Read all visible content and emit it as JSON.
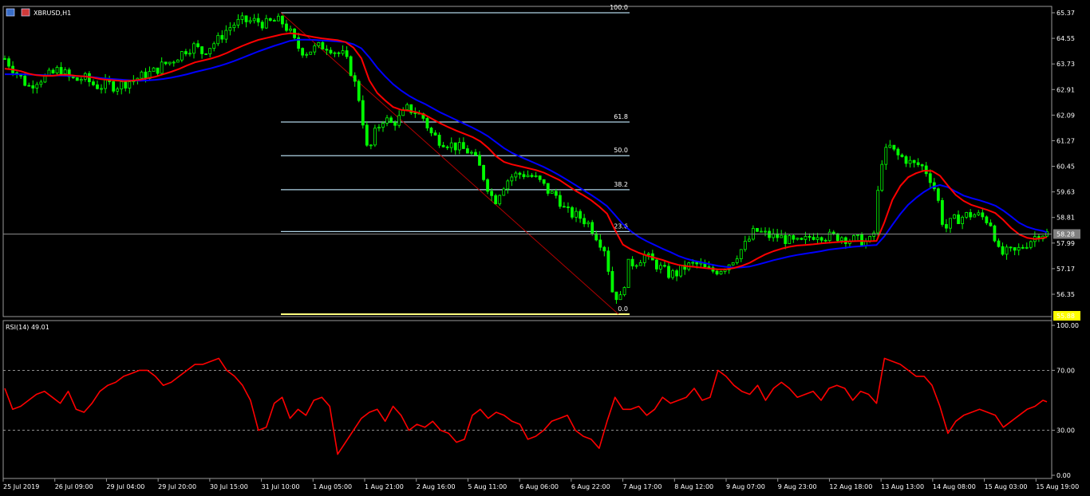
{
  "header": {
    "symbol_label": "XBRUSD,H1",
    "rsi_label": "RSI(14) 49.01"
  },
  "price_axis": {
    "ticks": [
      "65.37",
      "64.55",
      "63.73",
      "62.91",
      "62.09",
      "61.27",
      "60.45",
      "59.63",
      "58.81",
      "57.99",
      "57.17",
      "56.35"
    ],
    "tick_values": [
      65.37,
      64.55,
      63.73,
      62.91,
      62.09,
      61.27,
      60.45,
      59.63,
      58.81,
      57.99,
      57.17,
      56.35
    ],
    "current_price_label": "58.28",
    "current_price": 58.28,
    "low_price_label": "55.88",
    "low_price": 55.88
  },
  "rsi_axis": {
    "ticks": [
      "100.00",
      "70.00",
      "30.00",
      "0.00"
    ],
    "tick_values": [
      100,
      70,
      30,
      0
    ],
    "levels": [
      70,
      30
    ]
  },
  "time_axis": {
    "labels": [
      "25 Jul 2019",
      "26 Jul 09:00",
      "29 Jul 04:00",
      "29 Jul 20:00",
      "30 Jul 15:00",
      "31 Jul 10:00",
      "1 Aug 05:00",
      "1 Aug 21:00",
      "2 Aug 16:00",
      "5 Aug 11:00",
      "6 Aug 06:00",
      "6 Aug 22:00",
      "7 Aug 17:00",
      "8 Aug 12:00",
      "9 Aug 07:00",
      "9 Aug 23:00",
      "12 Aug 18:00",
      "13 Aug 13:00",
      "14 Aug 08:00",
      "15 Aug 03:00",
      "15 Aug 19:00"
    ]
  },
  "fibonacci": {
    "levels": [
      {
        "label": "100.0",
        "price": 65.37
      },
      {
        "label": "61.8",
        "price": 61.87
      },
      {
        "label": "50.0",
        "price": 60.79
      },
      {
        "label": "38.2",
        "price": 59.7
      },
      {
        "label": "23.6",
        "price": 58.36
      },
      {
        "label": "0.0",
        "price": 55.88
      }
    ]
  },
  "colors": {
    "background": "#000000",
    "candle": "#00ff00",
    "ma_fast": "#ff0000",
    "ma_slow": "#0000ff",
    "rsi": "#ff0000",
    "fib": "#b0d4e6",
    "fib_zero": "#ffff80",
    "grid_text": "#ffffff",
    "current_price_bg": "#808080",
    "low_price_bg": "#ffff00"
  },
  "chart_data": {
    "type": "line",
    "x": [
      0,
      10,
      20,
      30,
      40,
      50,
      60,
      70,
      80,
      90,
      100,
      110,
      120,
      130,
      140,
      150,
      160,
      170,
      180,
      190,
      200,
      210,
      220,
      230,
      240,
      250,
      260,
      270,
      280,
      290,
      300,
      310,
      320,
      330,
      340,
      350,
      360,
      370,
      380,
      390,
      400,
      410,
      420,
      430,
      440,
      450,
      460,
      470,
      480,
      490,
      500,
      510,
      520,
      530,
      540,
      550,
      560,
      570,
      580,
      590,
      600,
      610,
      620,
      630,
      640,
      650,
      660,
      670,
      680,
      690,
      700,
      710,
      720,
      730,
      740,
      750,
      760,
      770,
      780,
      790,
      800,
      810,
      820,
      830,
      840,
      850,
      860,
      870,
      880,
      890,
      900,
      910,
      920,
      930,
      940,
      950,
      960,
      970,
      980,
      990,
      1000,
      1010,
      1020,
      1030,
      1040,
      1050,
      1060,
      1070,
      1080,
      1090,
      1100,
      1110,
      1120,
      1130,
      1140,
      1150,
      1160,
      1170,
      1180,
      1190,
      1200,
      1210,
      1220,
      1230,
      1240,
      1250,
      1260,
      1270,
      1280,
      1290,
      1300,
      1310,
      1315
    ],
    "series": [
      {
        "values": [
          63.9,
          63.6,
          63.3,
          63.0,
          63.2,
          63.3,
          63.4,
          63.6,
          63.3,
          63.2,
          63.3,
          63.1,
          63.0,
          63.1,
          63.0,
          63.1,
          63.2,
          63.3,
          63.4,
          63.5,
          63.7,
          63.8,
          64.0,
          64.2,
          64.3,
          64.1,
          64.3,
          64.5,
          64.8,
          65.0,
          65.1,
          65.1,
          65.1,
          65.0,
          65.1,
          65.1,
          64.8,
          64.3,
          64.1,
          64.2,
          64.3,
          64.3,
          64.1,
          64.0,
          63.4,
          62.5,
          60.8,
          61.6,
          62.0,
          61.8,
          62.0,
          62.3,
          62.2,
          62.0,
          61.5,
          61.3,
          61.2,
          61.1,
          61.0,
          60.9,
          60.5,
          59.9,
          59.3,
          59.8,
          60.1,
          60.2,
          60.2,
          60.1,
          59.9,
          59.6,
          59.5,
          59.0,
          58.9,
          58.8,
          58.6,
          58.2,
          57.8,
          56.4,
          56.2,
          57.3,
          57.4,
          57.6,
          57.4,
          57.2,
          57.0,
          57.0,
          57.2,
          57.3,
          57.3,
          57.1,
          57.1,
          57.2,
          57.4,
          57.7,
          58.0,
          58.4,
          58.3,
          58.2,
          58.2,
          58.1,
          58.0,
          58.0,
          58.2,
          58.3,
          58.2,
          58.2,
          58.2,
          58.1,
          58.1,
          58.0,
          58.1,
          60.6,
          61.1,
          60.8,
          60.7,
          60.5,
          60.5,
          60.2,
          59.6,
          58.4,
          58.7,
          58.8,
          58.9,
          58.9,
          58.8,
          58.6,
          57.6,
          57.7,
          57.7,
          57.9,
          58.1,
          58.3,
          58.3
        ]
      },
      {
        "values": [
          63.58,
          63.55,
          63.5,
          63.42,
          63.37,
          63.35,
          63.35,
          63.38,
          63.38,
          63.35,
          63.33,
          63.3,
          63.25,
          63.22,
          63.2,
          63.18,
          63.19,
          63.22,
          63.27,
          63.32,
          63.4,
          63.48,
          63.57,
          63.68,
          63.78,
          63.84,
          63.9,
          63.98,
          64.08,
          64.2,
          64.31,
          64.41,
          64.5,
          64.56,
          64.62,
          64.68,
          64.71,
          64.69,
          64.64,
          64.59,
          64.55,
          64.52,
          64.49,
          64.43,
          64.25,
          63.91,
          63.2,
          62.8,
          62.56,
          62.35,
          62.26,
          62.23,
          62.18,
          62.1,
          61.96,
          61.82,
          61.7,
          61.59,
          61.49,
          61.39,
          61.25,
          61.04,
          60.77,
          60.59,
          60.51,
          60.45,
          60.39,
          60.33,
          60.25,
          60.13,
          60.01,
          59.84,
          59.67,
          59.52,
          59.36,
          59.16,
          58.93,
          58.41,
          57.94,
          57.79,
          57.68,
          57.59,
          57.52,
          57.45,
          57.36,
          57.29,
          57.25,
          57.23,
          57.2,
          57.17,
          57.15,
          57.15,
          57.19,
          57.26,
          57.36,
          57.5,
          57.63,
          57.73,
          57.81,
          57.87,
          57.91,
          57.93,
          57.95,
          57.98,
          58.0,
          58.02,
          58.04,
          58.05,
          58.06,
          58.05,
          58.06,
          58.66,
          59.37,
          59.82,
          60.1,
          60.23,
          60.31,
          60.3,
          60.15,
          59.83,
          59.53,
          59.34,
          59.21,
          59.13,
          59.05,
          58.95,
          58.73,
          58.47,
          58.27,
          58.16,
          58.12,
          58.15,
          58.18
        ]
      },
      {
        "values": [
          63.4,
          63.4,
          63.4,
          63.39,
          63.38,
          63.37,
          63.36,
          63.36,
          63.35,
          63.34,
          63.33,
          63.31,
          63.28,
          63.26,
          63.24,
          63.22,
          63.2,
          63.19,
          63.2,
          63.22,
          63.25,
          63.29,
          63.34,
          63.4,
          63.47,
          63.53,
          63.59,
          63.66,
          63.74,
          63.83,
          63.93,
          64.03,
          64.13,
          64.22,
          64.31,
          64.39,
          64.47,
          64.51,
          64.51,
          64.5,
          64.48,
          64.47,
          64.45,
          64.43,
          64.36,
          64.23,
          63.94,
          63.61,
          63.33,
          63.08,
          62.88,
          62.71,
          62.57,
          62.45,
          62.31,
          62.17,
          62.05,
          61.93,
          61.81,
          61.69,
          61.56,
          61.41,
          61.22,
          61.03,
          60.88,
          60.76,
          60.65,
          60.54,
          60.43,
          60.3,
          60.16,
          60.01,
          59.85,
          59.69,
          59.53,
          59.36,
          59.17,
          58.89,
          58.59,
          58.37,
          58.19,
          58.05,
          57.93,
          57.81,
          57.7,
          57.58,
          57.49,
          57.42,
          57.37,
          57.31,
          57.26,
          57.23,
          57.2,
          57.21,
          57.24,
          57.3,
          57.37,
          57.44,
          57.5,
          57.56,
          57.61,
          57.65,
          57.69,
          57.73,
          57.78,
          57.81,
          57.84,
          57.87,
          57.89,
          57.91,
          57.93,
          58.21,
          58.57,
          58.92,
          59.22,
          59.44,
          59.63,
          59.78,
          59.85,
          59.78,
          59.64,
          59.51,
          59.43,
          59.36,
          59.28,
          59.19,
          59.03,
          58.84,
          58.64,
          58.51,
          58.43,
          58.38,
          58.33
        ]
      },
      {
        "values": [
          58,
          44,
          46,
          50,
          54,
          56,
          52,
          48,
          56,
          44,
          42,
          48,
          56,
          60,
          62,
          66,
          68,
          70,
          70,
          66,
          60,
          62,
          66,
          70,
          74,
          74,
          76,
          78,
          70,
          66,
          60,
          50,
          30,
          32,
          48,
          52,
          38,
          44,
          40,
          50,
          52,
          46,
          14,
          22,
          30,
          38,
          42,
          44,
          36,
          46,
          40,
          30,
          34,
          32,
          36,
          30,
          28,
          22,
          24,
          40,
          44,
          38,
          42,
          40,
          36,
          34,
          24,
          26,
          30,
          36,
          38,
          40,
          30,
          26,
          24,
          18,
          36,
          52,
          44,
          44,
          46,
          40,
          44,
          52,
          48,
          50,
          52,
          58,
          50,
          52,
          70,
          66,
          60,
          56,
          54,
          60,
          50,
          58,
          62,
          58,
          52,
          54,
          56,
          50,
          58,
          60,
          58,
          50,
          56,
          54,
          48,
          78,
          76,
          74,
          70,
          66,
          66,
          60,
          46,
          28,
          36,
          40,
          42,
          44,
          42,
          40,
          32,
          36,
          40,
          44,
          46,
          50,
          49
        ]
      }
    ],
    "series_names": [
      "",
      "",
      "",
      ""
    ],
    "title": "",
    "xlabel": "",
    "ylabel": "",
    "ylim": [
      55.88,
      65.37
    ],
    "rsi_ylim": [
      0,
      100
    ],
    "grid": false,
    "legend": "none"
  }
}
